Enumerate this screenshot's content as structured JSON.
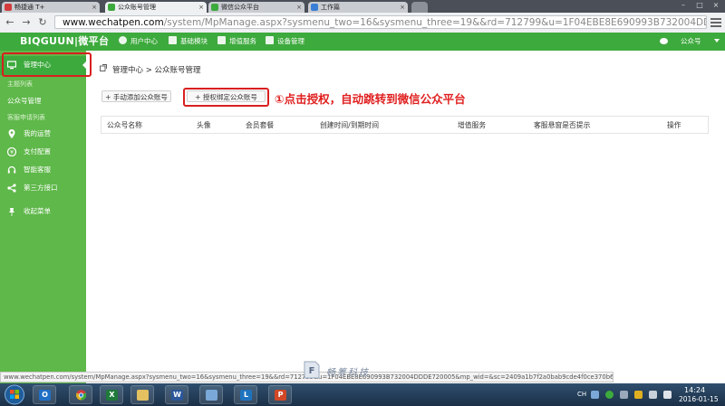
{
  "browser": {
    "tabs": [
      {
        "label": "畅捷通 T+",
        "icon_color": "#d23c3c"
      },
      {
        "label": "公众账号管理",
        "icon_color": "#3daa3d",
        "active": true
      },
      {
        "label": "微信公众平台",
        "icon_color": "#3daa3d"
      },
      {
        "label": "工作篇",
        "icon_color": "#3a7fd5"
      }
    ],
    "url_host": "www.wechatpen.com",
    "url_rest": "/system/MpManage.aspx?sysmenu_two=16&sysmenu_three=19&&rd=712799&u=1F04EBE8E690993B732004DDDE720005&mp_wid="
  },
  "app_header": {
    "logo": "BIQGUUN|微平台",
    "nav": [
      {
        "label": "用户中心"
      },
      {
        "label": "基础模块"
      },
      {
        "label": "增值服务"
      },
      {
        "label": "设备管理"
      }
    ],
    "user_label": "公众号"
  },
  "sidebar": {
    "active": {
      "label": "管理中心"
    },
    "sub_header_1": "主题列表",
    "mp_manage": "公众号管理",
    "sub_header_2": "客服申请列表",
    "items": [
      {
        "label": "我的运营"
      },
      {
        "label": "支付配置"
      },
      {
        "label": "智能客服"
      },
      {
        "label": "第三方接口"
      },
      {
        "label": "收起菜单"
      }
    ]
  },
  "main": {
    "breadcrumb": "管理中心 > 公众账号管理",
    "btn_manual": "+ 手动添加公众账号",
    "btn_authorize": "+ 授权绑定公众账号",
    "callout": "①点击授权，自动跳转到微信公众平台",
    "table_headers": [
      "公众号名称",
      "头像",
      "会员套餐",
      "创建时间/到期时间",
      "增值服务",
      "客服悬窗是否提示",
      "操作"
    ]
  },
  "status_url": "www.wechatpen.com/system/MpManage.aspx?sysmenu_two=16&sysmenu_three=19&&rd=712799&u=1F04EBE8E690993B732004DDDE720005&mp_wid=&sc=2409a1b7f2a0bab9cde4f0ce370b6993",
  "watermark": {
    "cn": "畅筹科技",
    "url": "www.yonyou.org.cn"
  },
  "taskbar": {
    "apps": [
      {
        "name": "outlook",
        "glyph": "O",
        "color": "#1f6fc5"
      },
      {
        "name": "chrome",
        "glyph": "",
        "color": "#e0b020"
      },
      {
        "name": "excel",
        "glyph": "X",
        "color": "#1e7a3a"
      },
      {
        "name": "folder",
        "glyph": "",
        "color": "#e3c060"
      },
      {
        "name": "word",
        "glyph": "W",
        "color": "#2b579a"
      },
      {
        "name": "window",
        "glyph": "",
        "color": "#7aa8d8"
      },
      {
        "name": "lync",
        "glyph": "L",
        "color": "#1e73be"
      },
      {
        "name": "powerpoint",
        "glyph": "P",
        "color": "#d24726"
      }
    ],
    "lang": "CH",
    "time": "14:24",
    "date": "2016-01-15"
  },
  "colors": {
    "green": "#3daa3d",
    "sidebar_green": "#5fb84a",
    "highlight_red": "#d91f1f"
  }
}
